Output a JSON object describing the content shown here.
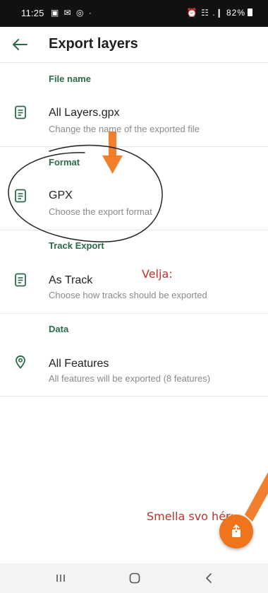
{
  "status_bar": {
    "time": "11:25",
    "notifications": "▣ ✉ ◎ ·",
    "right": "⏰ ☷ .❙ 82%"
  },
  "header": {
    "title": "Export layers"
  },
  "sections": [
    {
      "header": "File name",
      "title": "All Layers.gpx",
      "subtitle": "Change the name of the exported file",
      "icon": "document-icon"
    },
    {
      "header": "Format",
      "title": "GPX",
      "subtitle": "Choose the export format",
      "icon": "document-icon"
    },
    {
      "header": "Track Export",
      "title": "As Track",
      "subtitle": "Choose how tracks should be exported",
      "icon": "document-icon"
    },
    {
      "header": "Data",
      "title": "All Features",
      "subtitle": "All features will be exported (8 features)",
      "icon": "location-pin-icon"
    }
  ],
  "fab": {
    "icon": "export-icon",
    "color": "#f0741c"
  },
  "annotations": {
    "velja": "Velja:",
    "smella": "Smella svo hér:"
  },
  "colors": {
    "accent": "#2a6b47",
    "annotation_arrow": "#f0741c",
    "annotation_text": "#c1302b"
  },
  "nav_bar": {
    "buttons": [
      "recent-apps",
      "home",
      "back"
    ]
  }
}
